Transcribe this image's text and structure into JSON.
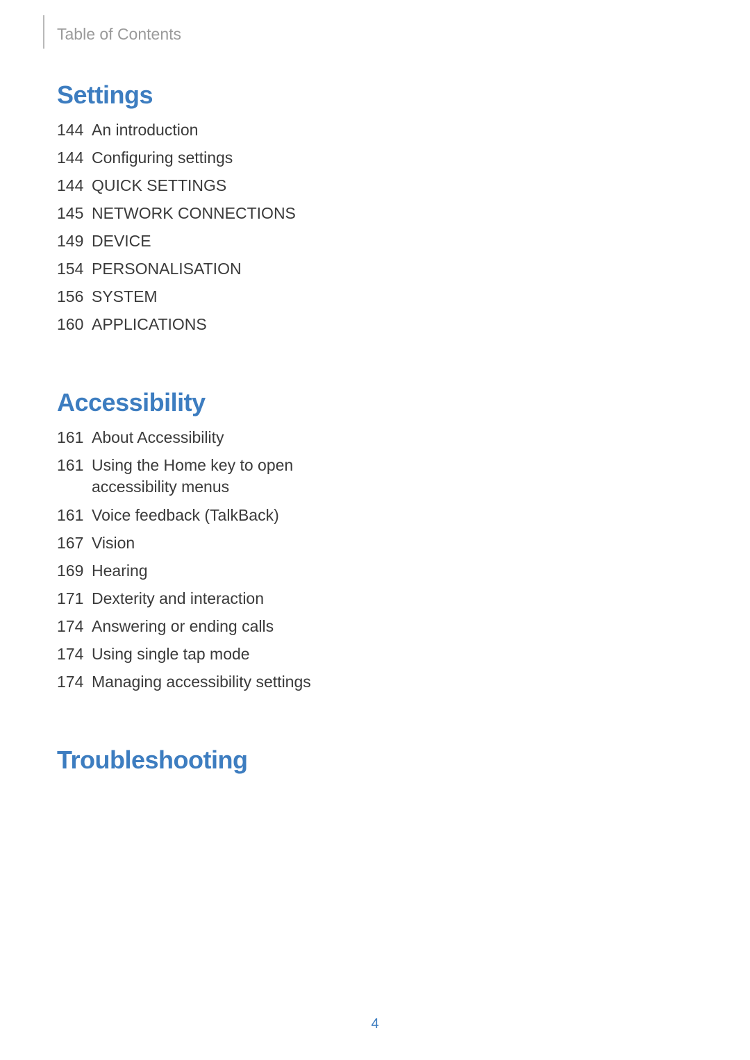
{
  "header": {
    "label": "Table of Contents"
  },
  "sections": [
    {
      "heading": "Settings",
      "entries": [
        {
          "page": "144",
          "title": "An introduction"
        },
        {
          "page": "144",
          "title": "Configuring settings"
        },
        {
          "page": "144",
          "title": "QUICK SETTINGS"
        },
        {
          "page": "145",
          "title": "NETWORK CONNECTIONS"
        },
        {
          "page": "149",
          "title": "DEVICE"
        },
        {
          "page": "154",
          "title": "PERSONALISATION"
        },
        {
          "page": "156",
          "title": "SYSTEM"
        },
        {
          "page": "160",
          "title": "APPLICATIONS"
        }
      ]
    },
    {
      "heading": "Accessibility",
      "entries": [
        {
          "page": "161",
          "title": "About Accessibility"
        },
        {
          "page": "161",
          "title": "Using the Home key to open accessibility menus"
        },
        {
          "page": "161",
          "title": "Voice feedback (TalkBack)"
        },
        {
          "page": "167",
          "title": "Vision"
        },
        {
          "page": "169",
          "title": "Hearing"
        },
        {
          "page": "171",
          "title": "Dexterity and interaction"
        },
        {
          "page": "174",
          "title": "Answering or ending calls"
        },
        {
          "page": "174",
          "title": "Using single tap mode"
        },
        {
          "page": "174",
          "title": "Managing accessibility settings"
        }
      ]
    },
    {
      "heading": "Troubleshooting",
      "entries": []
    }
  ],
  "pageNumber": "4"
}
